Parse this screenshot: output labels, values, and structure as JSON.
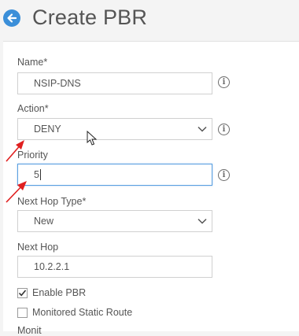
{
  "header": {
    "title": "Create PBR"
  },
  "form": {
    "name": {
      "label": "Name*",
      "value": "NSIP-DNS"
    },
    "action": {
      "label": "Action*",
      "value": "DENY"
    },
    "priority": {
      "label": "Priority",
      "value": "5"
    },
    "next_hop_type": {
      "label": "Next Hop Type*",
      "value": "New"
    },
    "next_hop": {
      "label": "Next Hop",
      "value": "10.2.2.1"
    },
    "enable_pbr": {
      "label": "Enable PBR",
      "checked": true
    },
    "monitored_static_route": {
      "label": "Monitored Static Route",
      "checked": false
    },
    "truncated_label": "Monit"
  },
  "colors": {
    "accent": "#3b8fd9",
    "annotation_arrow": "#e02020",
    "focus_border": "#5a9fe0"
  },
  "icons": {
    "back": "back-arrow-icon",
    "info": "info-icon",
    "dropdown": "chevron-down-icon",
    "pointer": "mouse-pointer-icon"
  }
}
